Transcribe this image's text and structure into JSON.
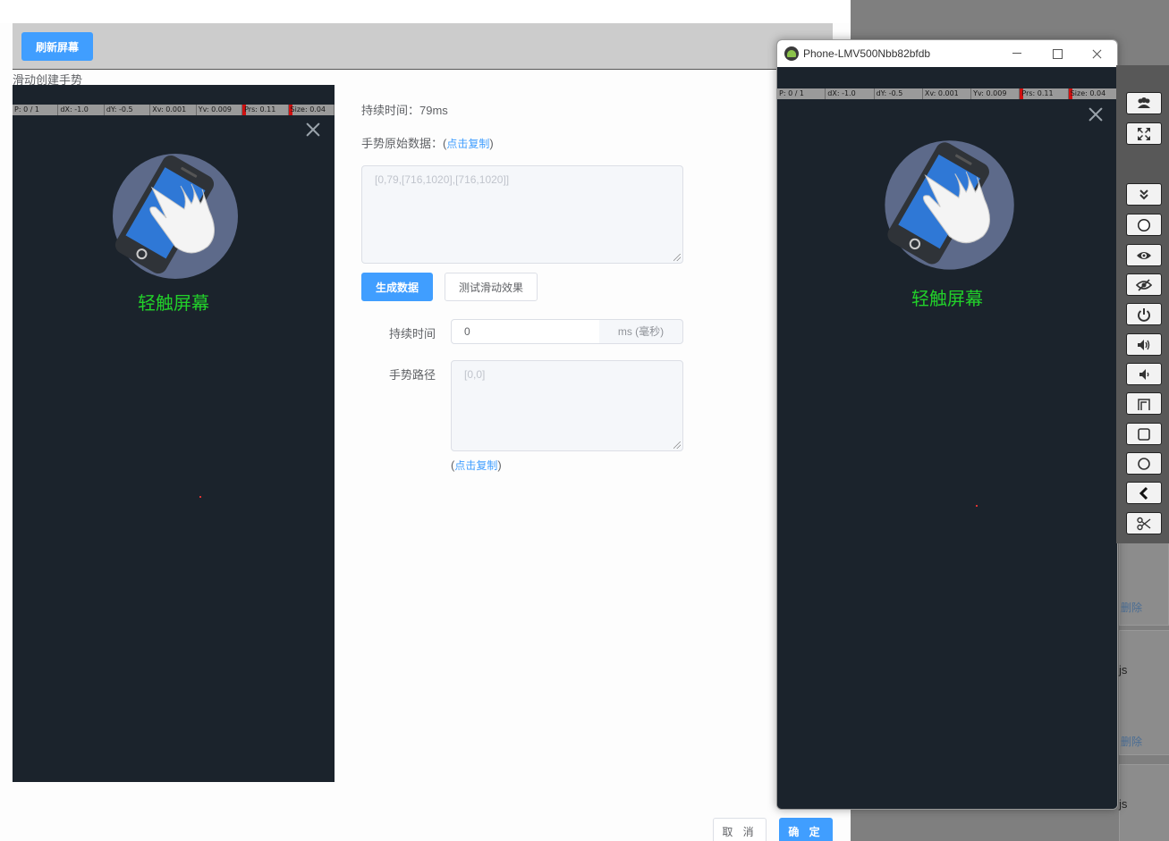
{
  "toolbar": {
    "refresh_label": "刷新屏幕"
  },
  "section_title": "滑动创建手势",
  "phone_status": {
    "p": "P: 0 / 1",
    "dx": "dX: -1.0",
    "dy": "dY: -0.5",
    "xv": "Xv: 0.001",
    "yv": "Yv: 0.009",
    "prs": "Prs: 0.11",
    "size": "Size: 0.04"
  },
  "phone_tap_text": "轻触屏幕",
  "form": {
    "duration_text": "持续时间：79ms",
    "raw_label": "手势原始数据：",
    "copy_label": "点击复制",
    "raw_placeholder": "[0,79,[716,1020],[716,1020]]",
    "generate_label": "生成数据",
    "test_label": "测试滑动效果",
    "duration_label": "持续时间",
    "duration_value": "0",
    "duration_unit": "ms (毫秒)",
    "path_label": "手势路径",
    "path_placeholder": "[0,0]"
  },
  "footer": {
    "cancel_label": "取 消",
    "ok_label": "确 定"
  },
  "phone_window": {
    "title": "Phone-LMV500Nbb82bfdb"
  },
  "background": {
    "delete_label": "删除",
    "js_label": "js"
  },
  "colors": {
    "primary": "#409eff",
    "tap_text": "#22d02a",
    "screen_bg": "#1b232c"
  },
  "side_controls": [
    "users-icon",
    "fullscreen-icon",
    "chevron-double-down-icon",
    "record-icon",
    "eye-icon",
    "eye-off-icon",
    "power-icon",
    "volume-up-icon",
    "volume-down-icon",
    "rotate-icon",
    "home-icon",
    "circle-icon",
    "back-icon",
    "screenshot-icon"
  ]
}
